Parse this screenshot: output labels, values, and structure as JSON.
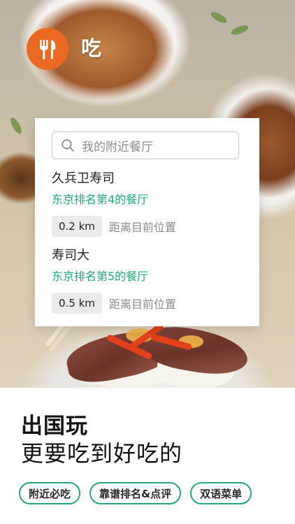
{
  "app": {
    "name": "吃",
    "icon": "fork-knife-icon",
    "brand_color": "#ea6a23"
  },
  "search": {
    "placeholder": "我的附近餐厅",
    "icon": "search-icon"
  },
  "restaurants": [
    {
      "name": "久兵卫寿司",
      "rank": "东京排名第4的餐厅",
      "distance": "0.2 km",
      "distance_label": "距离目前位置"
    },
    {
      "name": "寿司大",
      "rank": "东京排名第5的餐厅",
      "distance": "0.5 km",
      "distance_label": "距离目前位置"
    }
  ],
  "promo": {
    "headline": "出国玩",
    "subline": "更要吃到好吃的",
    "tags": [
      "附近必吃",
      "靠谱排名&点评",
      "双语菜单"
    ]
  },
  "colors": {
    "accent_green": "#25a67c",
    "text_dark": "#111111"
  }
}
